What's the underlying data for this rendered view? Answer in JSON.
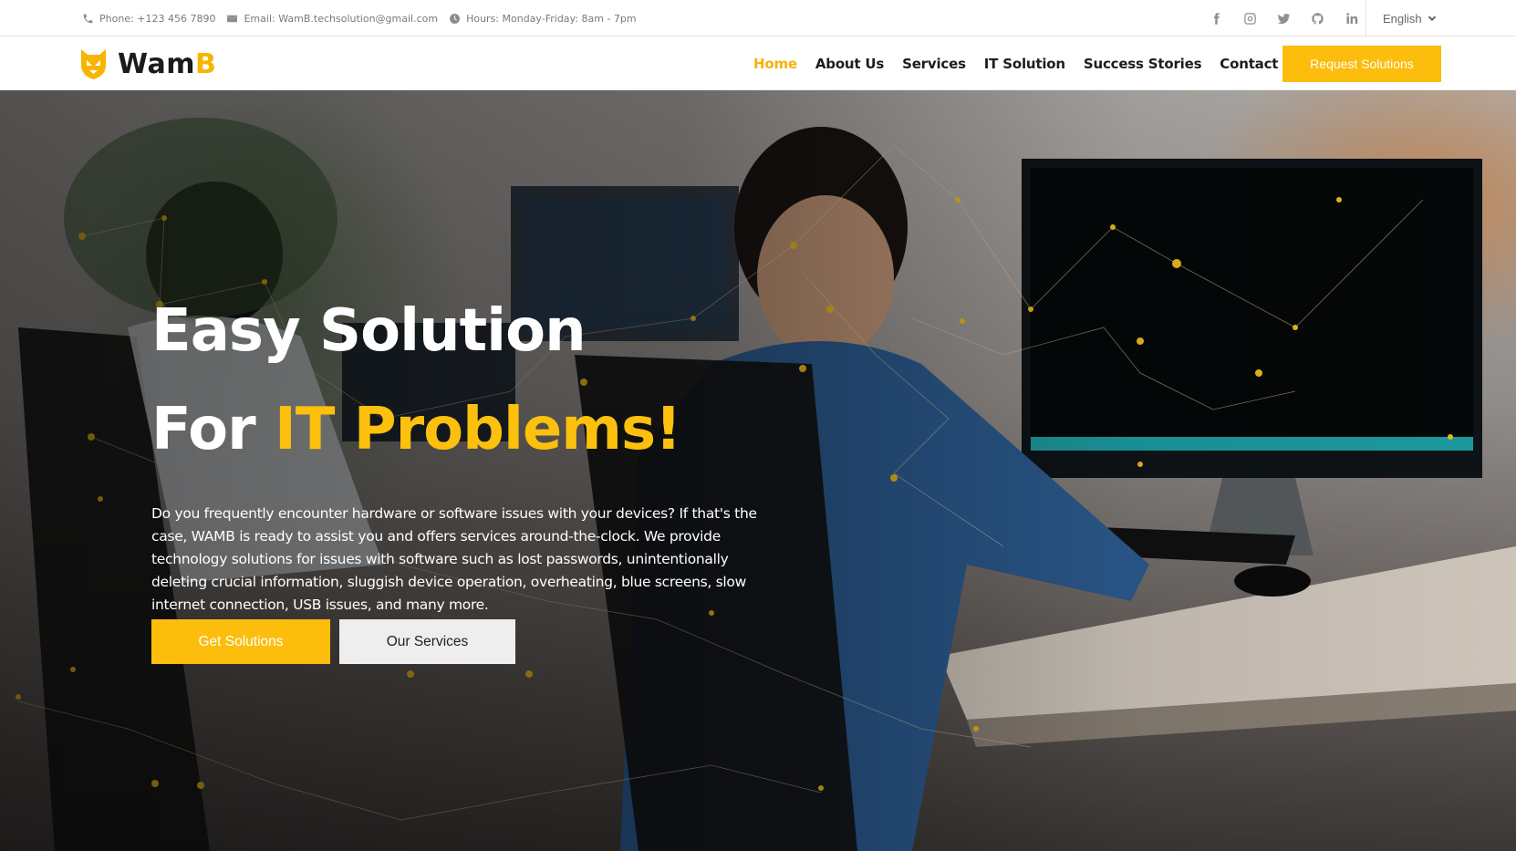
{
  "topbar": {
    "phone": "Phone: +123 456 7890",
    "email": "Email: WamB.techsolution@gmail.com",
    "hours": "Hours: Monday-Friday: 8am - 7pm",
    "socials": [
      "facebook-icon",
      "instagram-icon",
      "twitter-icon",
      "github-icon",
      "linkedin-icon"
    ],
    "language": "English"
  },
  "navbar": {
    "logo_main": "Wam",
    "logo_accent": "B",
    "items": [
      {
        "label": "Home",
        "active": true
      },
      {
        "label": "About Us",
        "active": false
      },
      {
        "label": "Services",
        "active": false
      },
      {
        "label": "IT Solution",
        "active": false
      },
      {
        "label": "Success Stories",
        "active": false
      },
      {
        "label": "Contact Us",
        "active": false
      }
    ],
    "cta": "Request Solutions"
  },
  "hero": {
    "line1": "Easy Solution",
    "line2_prefix": "For",
    "line2_highlight": "IT Problems!",
    "text": "Do you frequently encounter hardware or software issues with your devices? If that's the case, WAMB is ready to assist you and offers services around-the-clock. We provide technology solutions for issues with software such as lost passwords, unintentionally deleting crucial information, sluggish device operation, overheating, blue screens, slow internet connection, USB issues, and many more.",
    "primary_button": "Get Solutions",
    "secondary_button": "Our Services"
  },
  "colors": {
    "accent": "#fcbd0d",
    "nav_active": "#f5b10d",
    "text_dark": "#1d1d1d"
  }
}
